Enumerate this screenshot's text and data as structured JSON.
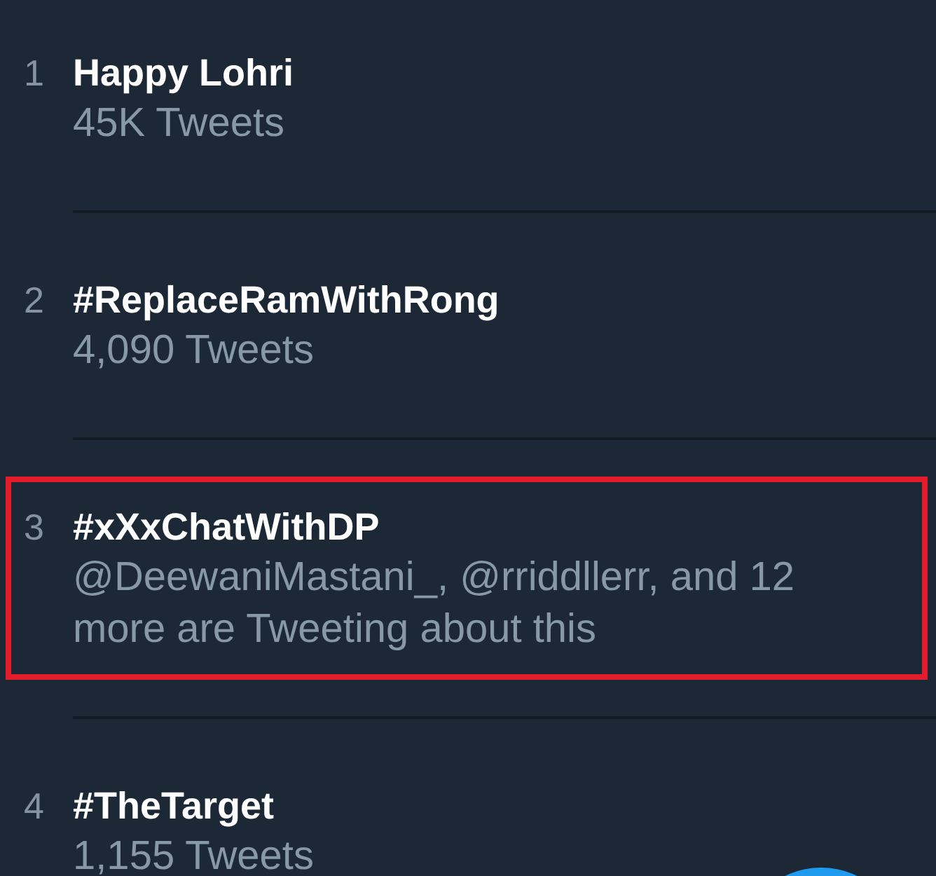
{
  "trends": [
    {
      "rank": "1",
      "name": "Happy Lohri",
      "context": "45K Tweets",
      "highlighted": false
    },
    {
      "rank": "2",
      "name": "#ReplaceRamWithRong",
      "context": "4,090 Tweets",
      "highlighted": false
    },
    {
      "rank": "3",
      "name": "#xXxChatWithDP",
      "context": "@DeewaniMastani_, @rriddllerr, and 12 more are Tweeting about this",
      "highlighted": true
    },
    {
      "rank": "4",
      "name": "#TheTarget",
      "context": "1,155 Tweets",
      "highlighted": false
    }
  ]
}
